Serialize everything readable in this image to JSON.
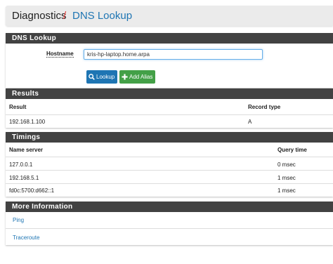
{
  "breadcrumb": {
    "section": "Diagnostics",
    "separator": "/",
    "page": "DNS Lookup"
  },
  "lookup_panel": {
    "title": "DNS Lookup",
    "hostname_label": "Hostname",
    "hostname_value": "kris-hp-laptop.home.arpa",
    "lookup_button": "Lookup",
    "add_alias_button": "Add Alias"
  },
  "results": {
    "title": "Results",
    "columns": [
      "Result",
      "Record type"
    ],
    "rows": [
      {
        "result": "192.168.1.100",
        "record_type": "A"
      }
    ]
  },
  "timings": {
    "title": "Timings",
    "columns": [
      "Name server",
      "Query time"
    ],
    "rows": [
      {
        "server": "127.0.0.1",
        "time": "0 msec"
      },
      {
        "server": "192.168.5.1",
        "time": "1 msec"
      },
      {
        "server": "fd0c:5700:d662::1",
        "time": "1 msec"
      }
    ]
  },
  "more_info": {
    "title": "More Information",
    "links": [
      "Ping",
      "Traceroute"
    ]
  },
  "colors": {
    "panel_header": "#424242",
    "link": "#1e75b3",
    "primary": "#1e75b3",
    "success": "#43a047",
    "separator": "#e53935"
  }
}
